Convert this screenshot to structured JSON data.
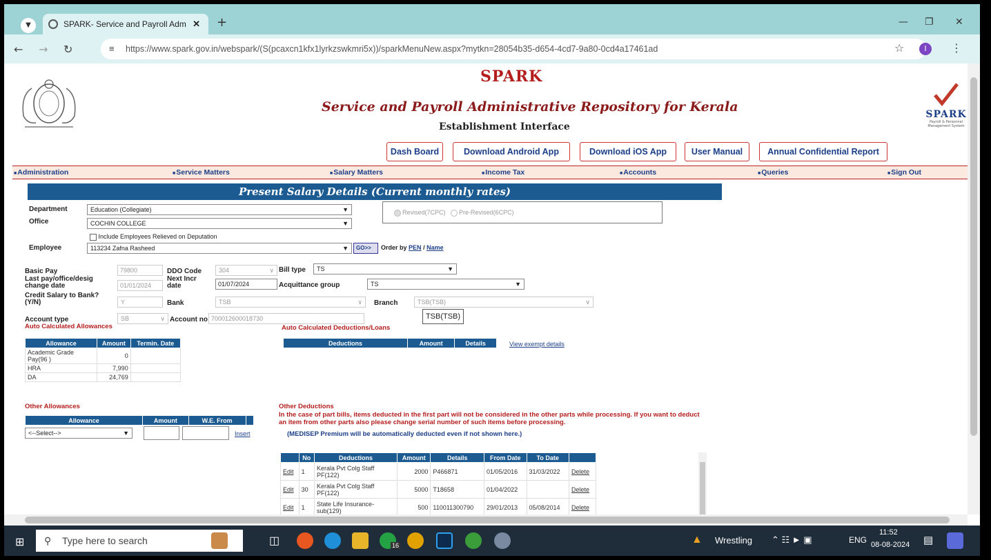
{
  "browser": {
    "tab_title": "SPARK- Service and Payroll Adm",
    "url": "https://www.spark.gov.in/webspark/(S(pcaxcn1kfx1lyrkzswkmri5x))/sparkMenuNew.aspx?mytkn=28054b35-d654-4cd7-9a80-0cd4a17461ad",
    "profile_initial": "I"
  },
  "header": {
    "logo_text": "SPARK",
    "title": "Service and Payroll Administrative Repository for Kerala",
    "subtitle": "Establishment Interface",
    "right_logo_text": "SPARK",
    "right_logo_caption": "Payroll & Personnel Management System",
    "buttons": [
      "Dash Board",
      "Download Android App",
      "Download iOS App",
      "User Manual",
      "Annual Confidential Report"
    ]
  },
  "menu": [
    "Administration",
    "Service Matters",
    "Salary Matters",
    "Income Tax",
    "Accounts",
    "Queries",
    "Sign Out"
  ],
  "form": {
    "heading": "Present Salary Details (Current monthly rates)",
    "department_label": "Department",
    "department_value": "Education (Collegiate)",
    "office_label": "Office",
    "office_value": "COCHIN COLLEGE",
    "include_label": "Include Employees Relieved on Deputation",
    "employee_label": "Employee",
    "employee_value": "113234 Zafna Rasheed",
    "go_label": "GO>>",
    "order_by_label": "Order by",
    "order_pen": "PEN",
    "order_sep": "/",
    "order_name": "Name",
    "revised_label": "Revised(7CPC)",
    "prerevised_label": "Pre-Revised(6CPC)",
    "basic_pay_label": "Basic Pay",
    "basic_pay_value": "79800",
    "ddo_code_label": "DDO Code",
    "ddo_code_value": "304",
    "bill_type_label": "Bill type",
    "bill_type_value": "TS",
    "last_pay_label": "Last pay/office/desig change date",
    "last_pay_value": "01/01/2024",
    "next_incr_label": "Next Incr date",
    "next_incr_value": "01/07/2024",
    "acq_group_label": "Acquittance group",
    "acq_group_value": "TS",
    "credit_label": "Credit Salary to Bank? (Y/N)",
    "credit_value": "Y",
    "bank_label": "Bank",
    "bank_value": "TSB",
    "branch_label": "Branch",
    "branch_value": "TSB(TSB)",
    "account_type_label": "Account type",
    "account_type_value": "SB",
    "account_no_label": "Account no",
    "account_no_value": "700012600018730",
    "tooltip": "TSB(TSB)"
  },
  "allowances": {
    "title": "Auto Calculated Allowances",
    "headers": [
      "Allowance",
      "Amount",
      "Termin. Date"
    ],
    "rows": [
      {
        "name": "Academic Grade Pay(96 )",
        "amount": "0",
        "date": ""
      },
      {
        "name": "HRA",
        "amount": "7,990",
        "date": ""
      },
      {
        "name": "DA",
        "amount": "24,769",
        "date": ""
      }
    ]
  },
  "deductions_auto": {
    "title": "Auto Calculated Deductions/Loans",
    "headers": [
      "Deductions",
      "Amount",
      "Details"
    ],
    "view_link": "View exempt details"
  },
  "other_allowances": {
    "title": "Other Allowances",
    "headers": [
      "Allowance",
      "Amount",
      "W.E. From"
    ],
    "select_value": "<--Select-->",
    "insert_label": "Insert"
  },
  "other_deductions": {
    "title": "Other Deductions",
    "note": "In the case of part bills, items deducted in the first part will not be considered in the other parts while processing. If you want to deduct an item from other parts also please change serial number of such items before processing.",
    "medisep_note": "(MEDISEP Premium will be automatically deducted even if not shown here.)",
    "headers": [
      "",
      "No",
      "Deductions",
      "Amount",
      "Details",
      "From Date",
      "To Date",
      ""
    ],
    "rows": [
      {
        "edit": "Edit",
        "no": "1",
        "deduction": "Kerala Pvt Colg Staff PF(122)",
        "amount": "2000",
        "details": "P466871",
        "from": "01/05/2016",
        "to": "31/03/2022",
        "delete": "Delete"
      },
      {
        "edit": "Edit",
        "no": "30",
        "deduction": "Kerala Pvt Colg Staff PF(122)",
        "amount": "5000",
        "details": "T18658",
        "from": "01/04/2022",
        "to": "",
        "delete": "Delete"
      },
      {
        "edit": "Edit",
        "no": "1",
        "deduction": "State Life Insurance-sub(129)",
        "amount": "500",
        "details": "110011300790",
        "from": "29/01/2013",
        "to": "05/08/2014",
        "delete": "Delete"
      }
    ]
  },
  "taskbar": {
    "search_placeholder": "Type here to search",
    "whatsapp_badge": "16",
    "weather": "Wrestling",
    "lang": "ENG",
    "time": "11:52",
    "date": "08-08-2024"
  }
}
